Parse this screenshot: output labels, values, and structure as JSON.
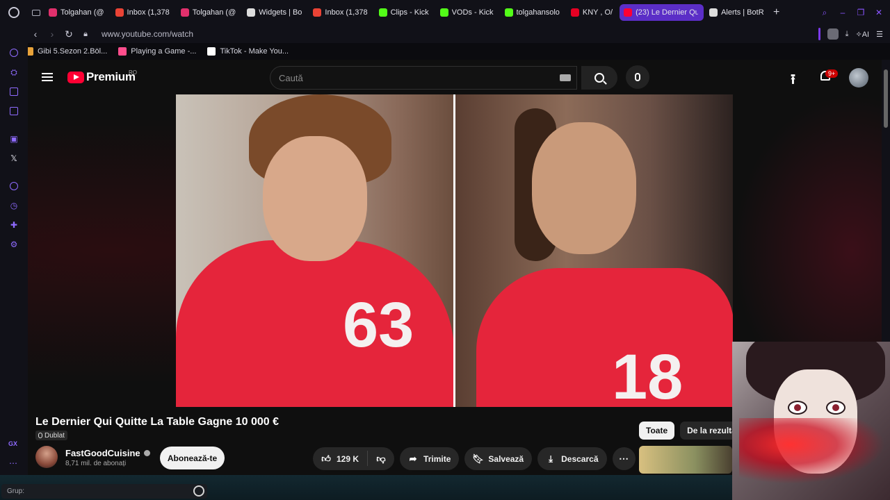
{
  "browser": {
    "tabs": [
      {
        "title": "Tolgahan (@",
        "favicon": "instagram-icon",
        "color": "#e1306c"
      },
      {
        "title": "Inbox (1,378",
        "favicon": "gmail-icon",
        "color": "#ea4335"
      },
      {
        "title": "Tolgahan (@",
        "favicon": "instagram-icon",
        "color": "#e1306c"
      },
      {
        "title": "Widgets | Bo",
        "favicon": "diamond-icon",
        "color": "#dddddd"
      },
      {
        "title": "Inbox (1,378",
        "favicon": "gmail-icon",
        "color": "#ea4335"
      },
      {
        "title": "Clips - Kick",
        "favicon": "kick-icon",
        "color": "#53fc18"
      },
      {
        "title": "VODs - Kick",
        "favicon": "kick-icon",
        "color": "#53fc18"
      },
      {
        "title": "tolgahansolo",
        "favicon": "kick-icon",
        "color": "#53fc18"
      },
      {
        "title": "KNY , O/",
        "favicon": "pinterest-icon",
        "color": "#e60023"
      },
      {
        "title": "(23) Le Dernier Qu",
        "favicon": "youtube-icon",
        "color": "#ff0033",
        "active": true
      },
      {
        "title": "Alerts | BotR",
        "favicon": "diamond-icon",
        "color": "#dddddd"
      }
    ],
    "url": "www.youtube.com/watch",
    "ai_label": "AI",
    "bookmarks": [
      {
        "label": "Gibi 5.Sezon 2.Böl...",
        "color": "#e8a23a"
      },
      {
        "label": "Playing a Game -...",
        "color": "#ff4d8d"
      },
      {
        "label": "TikTok - Make You...",
        "color": "#ffffff"
      }
    ],
    "accent": "#7c3aed"
  },
  "youtube": {
    "brand": "Premium",
    "region": "RO",
    "search_placeholder": "Caută",
    "notifications_badge": "9+",
    "video": {
      "title": "Le Dernier Qui Quitte La Table Gagne 10 000 €",
      "dub_label": "Dublat",
      "left_jersey": "63",
      "right_jersey": "18"
    },
    "channel": {
      "name": "FastGoodCuisine",
      "subscribers": "8,71 mil. de abonați",
      "subscribe_label": "Abonează-te"
    },
    "actions": {
      "likes": "129 K",
      "share": "Trimite",
      "save": "Salvează",
      "download": "Descarcă"
    },
    "chips": [
      "Toate",
      "De la rezultat"
    ]
  },
  "taskbar": {
    "group_label": "Grup:"
  },
  "sidebar_label": "GX"
}
